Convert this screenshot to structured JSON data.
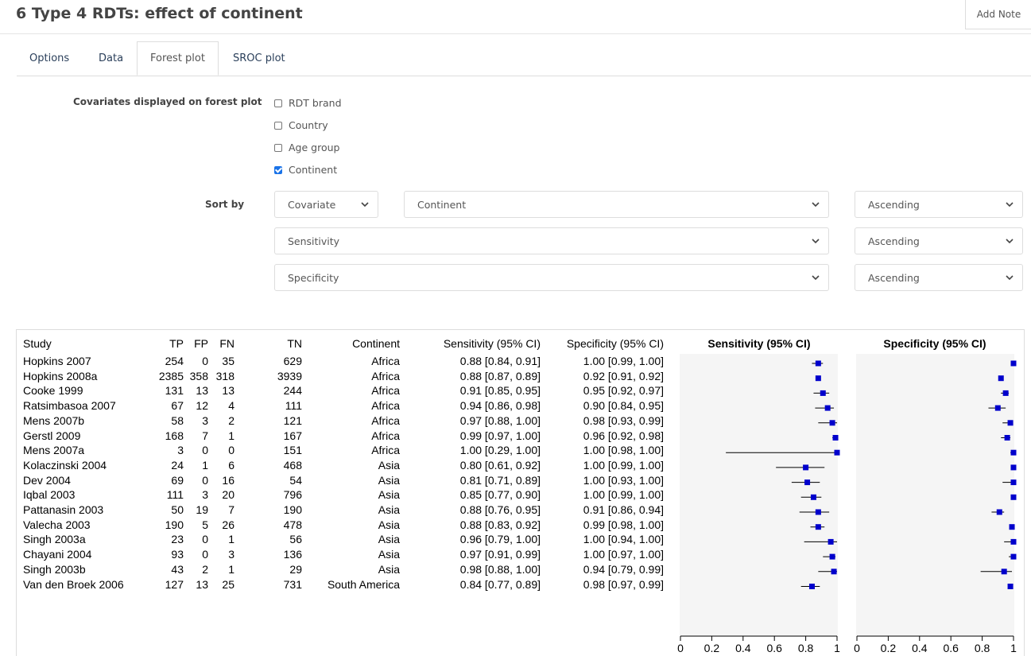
{
  "header": {
    "title": "6 Type 4 RDTs: effect of continent",
    "add_note": "Add Note"
  },
  "tabs": [
    {
      "label": "Options"
    },
    {
      "label": "Data"
    },
    {
      "label": "Forest plot"
    },
    {
      "label": "SROC plot"
    }
  ],
  "covariates": {
    "label": "Covariates displayed on forest plot",
    "items": [
      {
        "label": "RDT brand",
        "checked": false
      },
      {
        "label": "Country",
        "checked": false
      },
      {
        "label": "Age group",
        "checked": false
      },
      {
        "label": "Continent",
        "checked": true
      }
    ]
  },
  "sort": {
    "label": "Sort by",
    "row1": {
      "type": "Covariate",
      "field": "Continent",
      "order": "Ascending"
    },
    "row2": {
      "field": "Sensitivity",
      "order": "Ascending"
    },
    "row3": {
      "field": "Specificity",
      "order": "Ascending"
    }
  },
  "forest": {
    "columns": [
      "Study",
      "TP",
      "FP",
      "FN",
      "TN",
      "Continent",
      "Sensitivity (95% CI)",
      "Specificity (95% CI)"
    ],
    "sens_plot_title": "Sensitivity (95% CI)",
    "spec_plot_title": "Specificity (95% CI)",
    "marker_color": "#0000cc",
    "axis_ticks": [
      "0",
      "0.2",
      "0.4",
      "0.6",
      "0.8",
      "1"
    ],
    "rows": [
      {
        "study": "Hopkins 2007",
        "tp": "254",
        "fp": "0",
        "fn": "35",
        "tn": "629",
        "continent": "Africa",
        "sens_text": "0.88 [0.84, 0.91]",
        "spec_text": "1.00 [0.99, 1.00]",
        "sens": [
          0.88,
          0.84,
          0.91
        ],
        "spec": [
          1.0,
          0.99,
          1.0
        ]
      },
      {
        "study": "Hopkins 2008a",
        "tp": "2385",
        "fp": "358",
        "fn": "318",
        "tn": "3939",
        "continent": "Africa",
        "sens_text": "0.88 [0.87, 0.89]",
        "spec_text": "0.92 [0.91, 0.92]",
        "sens": [
          0.88,
          0.87,
          0.89
        ],
        "spec": [
          0.92,
          0.91,
          0.92
        ]
      },
      {
        "study": "Cooke 1999",
        "tp": "131",
        "fp": "13",
        "fn": "13",
        "tn": "244",
        "continent": "Africa",
        "sens_text": "0.91 [0.85, 0.95]",
        "spec_text": "0.95 [0.92, 0.97]",
        "sens": [
          0.91,
          0.85,
          0.95
        ],
        "spec": [
          0.95,
          0.92,
          0.97
        ]
      },
      {
        "study": "Ratsimbasoa 2007",
        "tp": "67",
        "fp": "12",
        "fn": "4",
        "tn": "111",
        "continent": "Africa",
        "sens_text": "0.94 [0.86, 0.98]",
        "spec_text": "0.90 [0.84, 0.95]",
        "sens": [
          0.94,
          0.86,
          0.98
        ],
        "spec": [
          0.9,
          0.84,
          0.95
        ]
      },
      {
        "study": "Mens 2007b",
        "tp": "58",
        "fp": "3",
        "fn": "2",
        "tn": "121",
        "continent": "Africa",
        "sens_text": "0.97 [0.88, 1.00]",
        "spec_text": "0.98 [0.93, 0.99]",
        "sens": [
          0.97,
          0.88,
          1.0
        ],
        "spec": [
          0.98,
          0.93,
          0.99
        ]
      },
      {
        "study": "Gerstl 2009",
        "tp": "168",
        "fp": "7",
        "fn": "1",
        "tn": "167",
        "continent": "Africa",
        "sens_text": "0.99 [0.97, 1.00]",
        "spec_text": "0.96 [0.92, 0.98]",
        "sens": [
          0.99,
          0.97,
          1.0
        ],
        "spec": [
          0.96,
          0.92,
          0.98
        ]
      },
      {
        "study": "Mens 2007a",
        "tp": "3",
        "fp": "0",
        "fn": "0",
        "tn": "151",
        "continent": "Africa",
        "sens_text": "1.00 [0.29, 1.00]",
        "spec_text": "1.00 [0.98, 1.00]",
        "sens": [
          1.0,
          0.29,
          1.0
        ],
        "spec": [
          1.0,
          0.98,
          1.0
        ]
      },
      {
        "study": "Kolaczinski 2004",
        "tp": "24",
        "fp": "1",
        "fn": "6",
        "tn": "468",
        "continent": "Asia",
        "sens_text": "0.80 [0.61, 0.92]",
        "spec_text": "1.00 [0.99, 1.00]",
        "sens": [
          0.8,
          0.61,
          0.92
        ],
        "spec": [
          1.0,
          0.99,
          1.0
        ]
      },
      {
        "study": "Dev 2004",
        "tp": "69",
        "fp": "0",
        "fn": "16",
        "tn": "54",
        "continent": "Asia",
        "sens_text": "0.81 [0.71, 0.89]",
        "spec_text": "1.00 [0.93, 1.00]",
        "sens": [
          0.81,
          0.71,
          0.89
        ],
        "spec": [
          1.0,
          0.93,
          1.0
        ]
      },
      {
        "study": "Iqbal 2003",
        "tp": "111",
        "fp": "3",
        "fn": "20",
        "tn": "796",
        "continent": "Asia",
        "sens_text": "0.85 [0.77, 0.90]",
        "spec_text": "1.00 [0.99, 1.00]",
        "sens": [
          0.85,
          0.77,
          0.9
        ],
        "spec": [
          1.0,
          0.99,
          1.0
        ]
      },
      {
        "study": "Pattanasin 2003",
        "tp": "50",
        "fp": "19",
        "fn": "7",
        "tn": "190",
        "continent": "Asia",
        "sens_text": "0.88 [0.76, 0.95]",
        "spec_text": "0.91 [0.86, 0.94]",
        "sens": [
          0.88,
          0.76,
          0.95
        ],
        "spec": [
          0.91,
          0.86,
          0.94
        ]
      },
      {
        "study": "Valecha 2003",
        "tp": "190",
        "fp": "5",
        "fn": "26",
        "tn": "478",
        "continent": "Asia",
        "sens_text": "0.88 [0.83, 0.92]",
        "spec_text": "0.99 [0.98, 1.00]",
        "sens": [
          0.88,
          0.83,
          0.92
        ],
        "spec": [
          0.99,
          0.98,
          1.0
        ]
      },
      {
        "study": "Singh 2003a",
        "tp": "23",
        "fp": "0",
        "fn": "1",
        "tn": "56",
        "continent": "Asia",
        "sens_text": "0.96 [0.79, 1.00]",
        "spec_text": "1.00 [0.94, 1.00]",
        "sens": [
          0.96,
          0.79,
          1.0
        ],
        "spec": [
          1.0,
          0.94,
          1.0
        ]
      },
      {
        "study": "Chayani 2004",
        "tp": "93",
        "fp": "0",
        "fn": "3",
        "tn": "136",
        "continent": "Asia",
        "sens_text": "0.97 [0.91, 0.99]",
        "spec_text": "1.00 [0.97, 1.00]",
        "sens": [
          0.97,
          0.91,
          0.99
        ],
        "spec": [
          1.0,
          0.97,
          1.0
        ]
      },
      {
        "study": "Singh 2003b",
        "tp": "43",
        "fp": "2",
        "fn": "1",
        "tn": "29",
        "continent": "Asia",
        "sens_text": "0.98 [0.88, 1.00]",
        "spec_text": "0.94 [0.79, 0.99]",
        "sens": [
          0.98,
          0.88,
          1.0
        ],
        "spec": [
          0.94,
          0.79,
          0.99
        ]
      },
      {
        "study": "Van den Broek 2006",
        "tp": "127",
        "fp": "13",
        "fn": "25",
        "tn": "731",
        "continent": "South America",
        "sens_text": "0.84 [0.77, 0.89]",
        "spec_text": "0.98 [0.97, 0.99]",
        "sens": [
          0.84,
          0.77,
          0.89
        ],
        "spec": [
          0.98,
          0.97,
          0.99
        ]
      }
    ]
  }
}
